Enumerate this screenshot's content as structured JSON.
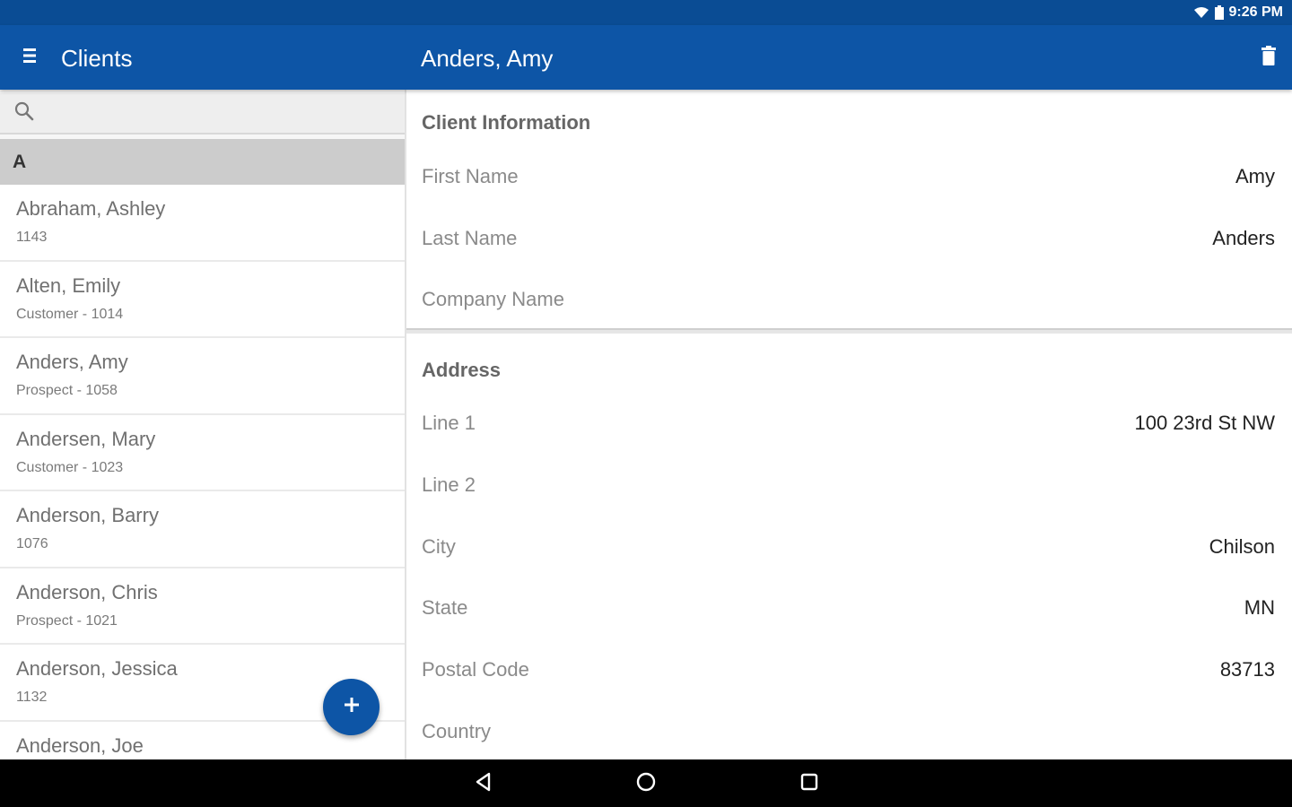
{
  "status_bar": {
    "time": "9:26 PM"
  },
  "app_bar": {
    "title": "Clients",
    "detail_title": "Anders, Amy"
  },
  "search": {
    "placeholder": ""
  },
  "section_letter": "A",
  "clients": [
    {
      "name": "Abraham, Ashley",
      "sub": "1143"
    },
    {
      "name": "Alten, Emily",
      "sub": "Customer - 1014"
    },
    {
      "name": "Anders, Amy",
      "sub": "Prospect - 1058"
    },
    {
      "name": "Andersen, Mary",
      "sub": "Customer - 1023"
    },
    {
      "name": "Anderson, Barry",
      "sub": "1076"
    },
    {
      "name": "Anderson, Chris",
      "sub": "Prospect - 1021"
    },
    {
      "name": "Anderson, Jessica",
      "sub": "1132"
    },
    {
      "name": "Anderson, Joe",
      "sub": ""
    }
  ],
  "client_info": {
    "title": "Client Information",
    "first_name_label": "First Name",
    "first_name": "Amy",
    "last_name_label": "Last Name",
    "last_name": "Anders",
    "company_name_label": "Company Name",
    "company_name": ""
  },
  "address": {
    "title": "Address",
    "line1_label": "Line 1",
    "line1": "100 23rd St NW",
    "line2_label": "Line 2",
    "line2": "",
    "city_label": "City",
    "city": "Chilson",
    "state_label": "State",
    "state": "MN",
    "postal_label": "Postal Code",
    "postal": "83713",
    "country_label": "Country",
    "country": ""
  },
  "colors": {
    "primary": "#0d55a6",
    "status_bar": "#0a4c94",
    "section_header": "#cccccc"
  }
}
